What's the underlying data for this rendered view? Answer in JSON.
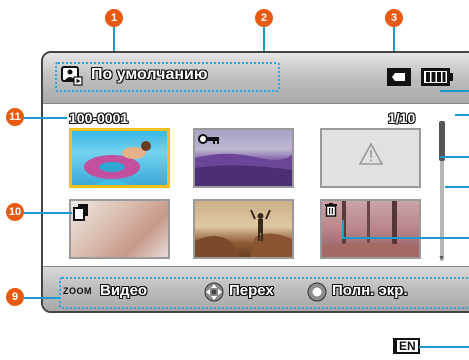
{
  "callouts": {
    "c1": "1",
    "c2": "2",
    "c3": "3",
    "c9": "9",
    "c10": "10",
    "c11": "11"
  },
  "header": {
    "mode_label": "По умолчанию",
    "mode_icon": "playback-folder-icon",
    "card_icon": "memory-card-icon",
    "battery_icon": "battery-icon"
  },
  "file_number": "100-0001",
  "page_counter": "1/10",
  "thumbnails": [
    {
      "name": "thumb-pool",
      "desc": "woman on pink float in pool",
      "selected": true
    },
    {
      "name": "thumb-lavender",
      "icon": "protect-key-icon",
      "selected": false
    },
    {
      "name": "thumb-error",
      "icon": "warning-icon",
      "selected": false
    },
    {
      "name": "thumb-snow",
      "icon": "copy-icon",
      "selected": false
    },
    {
      "name": "thumb-hiker",
      "selected": false
    },
    {
      "name": "thumb-forest",
      "icon": "delete-trash-icon",
      "selected": false
    }
  ],
  "bottom": {
    "zoom_label": "ZOOM",
    "zoom_action": "Видео",
    "dpad_icon": "dpad-icon",
    "move_action": "Перех",
    "ok_icon": "ok-button-icon",
    "full_action": "Полн. экр."
  },
  "footer": {
    "lang_badge": "EN"
  },
  "colors": {
    "callout": "#e85a12",
    "leader": "#1b9bd1",
    "selection": "#f3c019"
  }
}
